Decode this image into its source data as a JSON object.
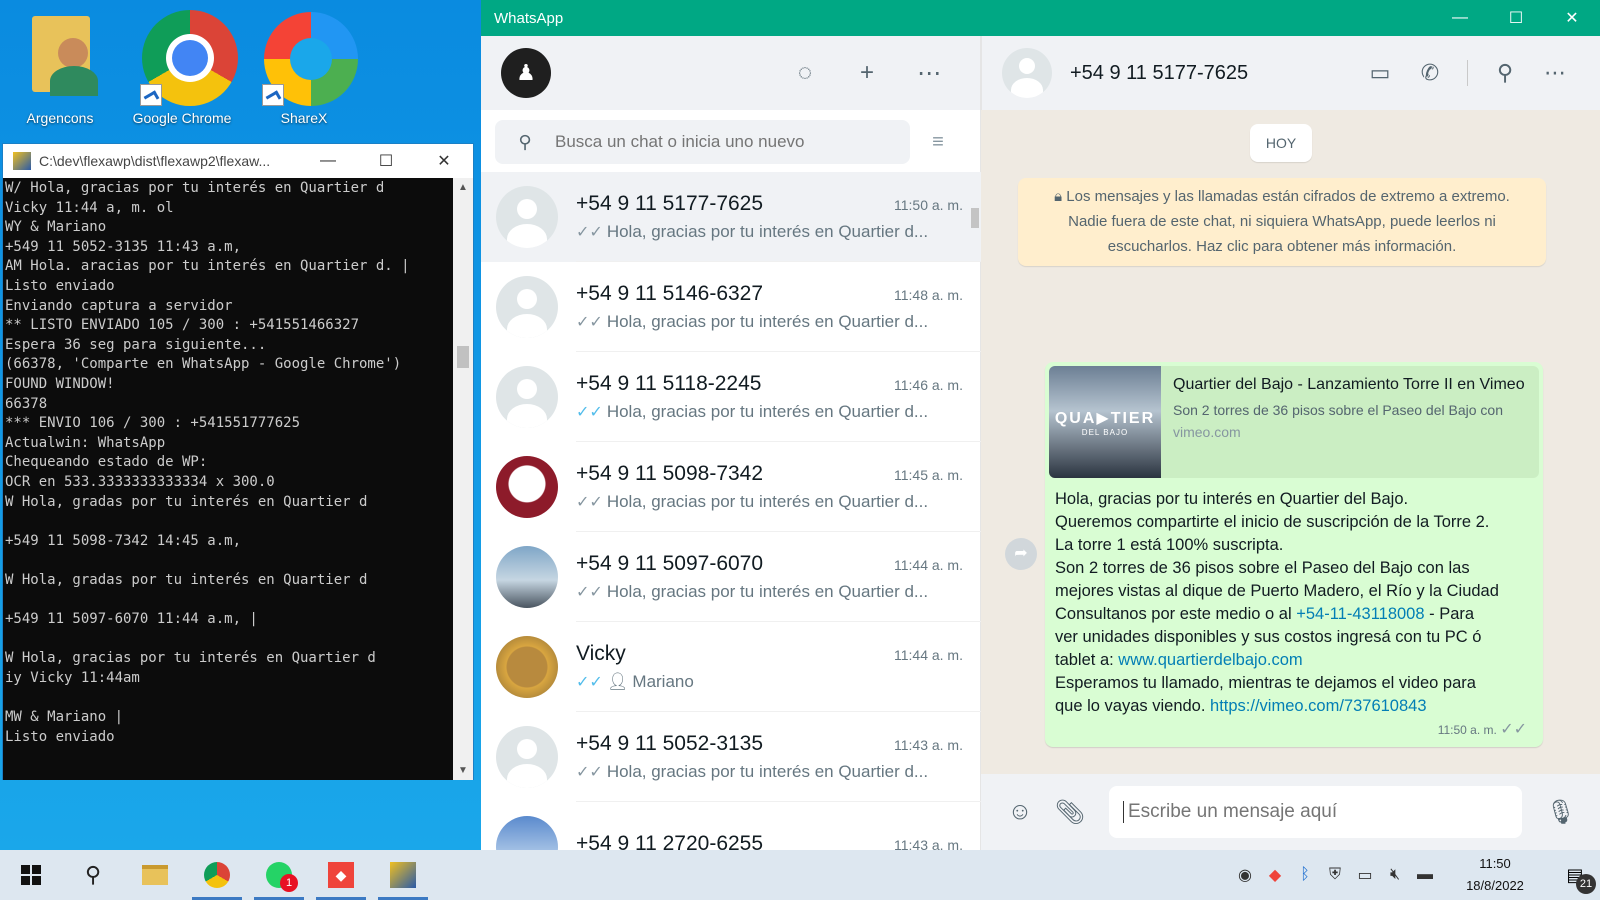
{
  "desktop": {
    "icons": [
      {
        "label": "Argencons"
      },
      {
        "label": "Google Chrome"
      },
      {
        "label": "ShareX"
      }
    ]
  },
  "console": {
    "title": "C:\\dev\\flexawp\\dist\\flexawp2\\flexaw...",
    "lines": [
      "W/ Hola, gracias por tu interés en Quartier d",
      "Vicky 11:44 a, m. ol",
      "WY & Mariano",
      "+549 11 5052-3135 11:43 a.m,",
      "AM Hola. aracias por tu interés en Quartier d. |",
      "Listo enviado",
      "Enviando captura a servidor",
      "** LISTO ENVIADO 105 / 300 : +541551466327",
      "Espera 36 seg para siguiente...",
      "(66378, 'Comparte en WhatsApp - Google Chrome')",
      "FOUND WINDOW!",
      "66378",
      "*** ENVIO 106 / 300 : +541551777625",
      "Actualwin: WhatsApp",
      "Chequeando estado de WP:",
      "OCR en 533.3333333333334 x 300.0",
      "W Hola, gradas por tu interés en Quartier d",
      "",
      "+549 11 5098-7342 14:45 a.m,",
      "",
      "W Hola, gradas por tu interés en Quartier d",
      "",
      "+549 11 5097-6070 11:44 a.m, |",
      "",
      "W Hola, gracias por tu interés en Quartier d",
      "iy Vicky 11:44am",
      "",
      "MW & Mariano |",
      "Listo enviado"
    ]
  },
  "whatsapp": {
    "title": "WhatsApp",
    "search_placeholder": "Busca un chat o inicia uno nuevo",
    "chats": [
      {
        "name": "+54 9 11 5177-7625",
        "time": "11:50 a. m.",
        "preview": "Hola, gracias por tu interés en Quartier d...",
        "read": false,
        "avatar": "default"
      },
      {
        "name": "+54 9 11 5146-6327",
        "time": "11:48 a. m.",
        "preview": "Hola, gracias por tu interés en Quartier d...",
        "read": false,
        "avatar": "default"
      },
      {
        "name": "+54 9 11 5118-2245",
        "time": "11:46 a. m.",
        "preview": "Hola, gracias por tu interés en Quartier d...",
        "read": true,
        "avatar": "default"
      },
      {
        "name": "+54 9 11 5098-7342",
        "time": "11:45 a. m.",
        "preview": "Hola, gracias por tu interés en Quartier d...",
        "read": false,
        "avatar": "seal"
      },
      {
        "name": "+54 9 11 5097-6070",
        "time": "11:44 a. m.",
        "preview": "Hola, gracias por tu interés en Quartier d...",
        "read": false,
        "avatar": "photo1"
      },
      {
        "name": "Vicky",
        "time": "11:44 a. m.",
        "preview": "Mariano",
        "read": true,
        "avatar": "photo2"
      },
      {
        "name": "+54 9 11 5052-3135",
        "time": "11:43 a. m.",
        "preview": "Hola, gracias por tu interés en Quartier d...",
        "read": false,
        "avatar": "default"
      },
      {
        "name": "+54 9 11 2720-6255",
        "time": "11:43 a. m.",
        "preview": "",
        "read": false,
        "avatar": "photo3"
      }
    ],
    "conversation": {
      "contact": "+54 9 11 5177-7625",
      "date_pill": "HOY",
      "encryption_note": "Los mensajes y las llamadas están cifrados de extremo a extremo. Nadie fuera de este chat, ni siquiera WhatsApp, puede leerlos ni escucharlos. Haz clic para obtener más información.",
      "link_preview": {
        "thumb_text": "QUA▶TIER",
        "thumb_sub": "DEL BAJO",
        "title": "Quartier del Bajo - Lanzamiento Torre II en Vimeo",
        "description": "Son 2 torres de 36 pisos sobre el Paseo del Bajo con",
        "domain": "vimeo.com"
      },
      "message": {
        "l1": "Hola, gracias por tu interés en Quartier del Bajo.",
        "l2": "Queremos compartirte el inicio de suscripción de la Torre 2.",
        "l3": "La torre 1 está 100% suscripta.",
        "l4": "Son 2 torres de 36 pisos sobre el Paseo del Bajo con las",
        "l5": "mejores vistas al dique de Puerto Madero, el Río y la Ciudad",
        "l6a": "Consultanos por este medio o al ",
        "l6link": "+54-11-43118008",
        "l6b": " - Para",
        "l7": "ver unidades disponibles y sus costos ingresá con tu PC ó",
        "l8a": "tablet a: ",
        "l8link": "www.quartierdelbajo.com",
        "l9": "Esperamos tu llamado, mientras te dejamos el video para",
        "l10a": "que lo vayas viendo. ",
        "l10link": "https://vimeo.com/737610843",
        "time": "11:50 a. m."
      },
      "composer_placeholder": "Escribe un mensaje aquí"
    }
  },
  "taskbar": {
    "whatsapp_badge": "1",
    "clock_time": "11:50",
    "clock_date": "18/8/2022",
    "notifications": "21"
  }
}
